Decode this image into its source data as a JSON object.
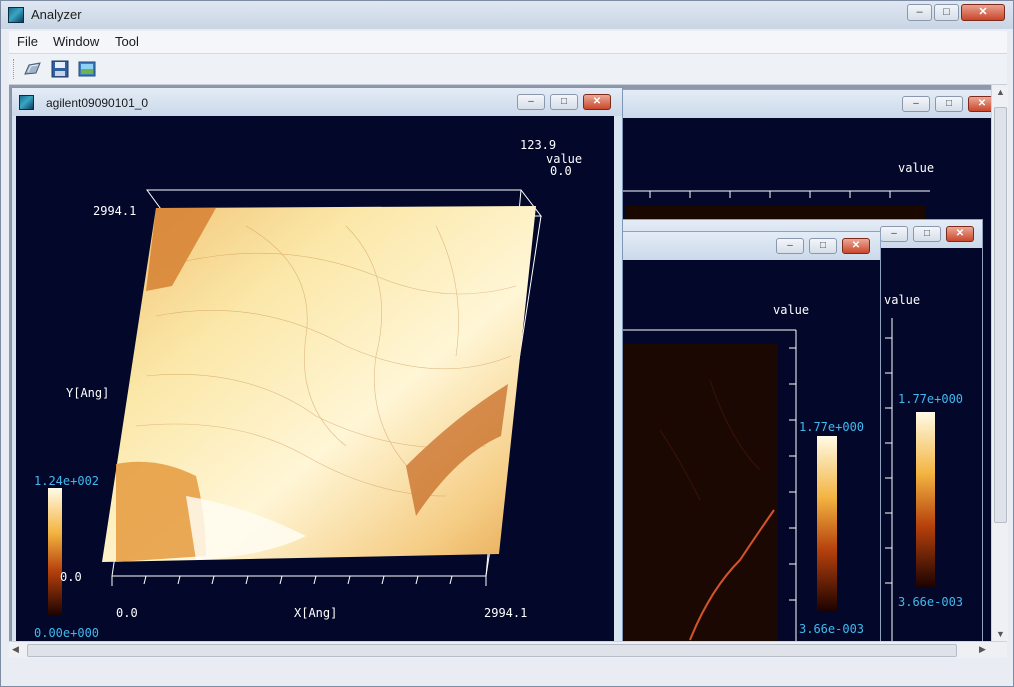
{
  "app": {
    "title": "Analyzer",
    "icon": "app-icon",
    "window_controls": [
      "minimize",
      "maximize",
      "close"
    ]
  },
  "menu": {
    "file": "File",
    "window": "Window",
    "tool": "Tool"
  },
  "toolbar": {
    "icons": [
      "open-file-icon",
      "save-icon",
      "image-icon"
    ]
  },
  "windows": {
    "front": {
      "title": "agilent09090101_0",
      "value_max": "123.9",
      "value_label": "value",
      "value_min": "0.0",
      "y_max": "2994.1",
      "y_label": "Y[Ang]",
      "x_min": "0.0",
      "x_label": "X[Ang]",
      "x_max": "2994.1",
      "cbar_max": "1.24e+002",
      "cbar_mid": "0.0",
      "cbar_min": "0.00e+000"
    },
    "middle": {
      "value_label": "value",
      "cbar_max": "1.77e+000",
      "cbar_min": "3.66e-003"
    },
    "right": {
      "value_label": "value",
      "cbar_max": "1.77e+000",
      "cbar_min": "3.66e-003"
    },
    "back": {
      "value_label": "value"
    }
  },
  "colors": {
    "plot_background": "#03082a",
    "axis_label": "#42b8ee",
    "surface_light": "#fffbe6",
    "surface_dark": "#a0320a"
  }
}
